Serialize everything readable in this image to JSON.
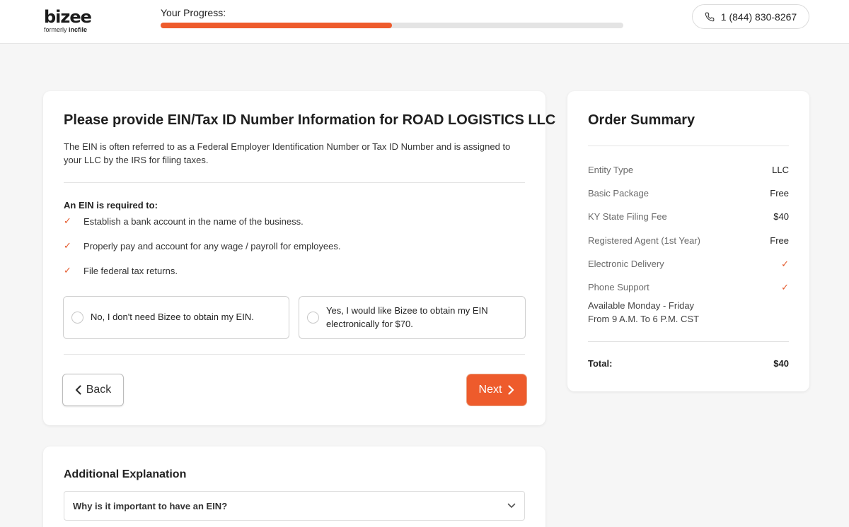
{
  "header": {
    "logo_text": "bizee",
    "logo_sub_prefix": "formerly ",
    "logo_sub_brand": "incfile",
    "progress_label": "Your Progress:",
    "progress_fraction": 0.5,
    "phone": "1 (844) 830-8267",
    "phone_icon": "phone-icon"
  },
  "main": {
    "title": "Please provide EIN/Tax ID Number Information for ROAD LOGISTICS LLC",
    "description": "The EIN is often referred to as a Federal Employer Identification Number or Tax ID Number and is assigned to your LLC by the IRS for filing taxes.",
    "requirements_title": "An EIN is required to:",
    "requirements": [
      "Establish a bank account in the name of the business.",
      "Properly pay and account for any wage / payroll for employees.",
      "File federal tax returns."
    ],
    "check_glyph": "✓",
    "options": [
      "No, I don't need Bizee to obtain my EIN.",
      "Yes, I would like Bizee to obtain my EIN electronically for $70."
    ],
    "back_label": "Back",
    "next_label": "Next"
  },
  "summary": {
    "title": "Order Summary",
    "rows": [
      {
        "label": "Entity Type",
        "value": "LLC"
      },
      {
        "label": "Basic Package",
        "value": "Free"
      },
      {
        "label": "KY State Filing Fee",
        "value": "$40"
      },
      {
        "label": "Registered Agent (1st Year)",
        "value": "Free"
      },
      {
        "label": "Electronic Delivery",
        "value": "✓"
      },
      {
        "label": "Phone Support",
        "value": "✓"
      }
    ],
    "availability_line1": "Available Monday - Friday",
    "availability_line2": "From 9 A.M. To 6 P.M. CST",
    "total_label": "Total:",
    "total_value": "$40"
  },
  "explanation": {
    "title": "Additional Explanation",
    "question": "Why is it important to have an EIN?"
  },
  "colors": {
    "accent": "#ee5b2c",
    "background": "#f6f6f6"
  }
}
